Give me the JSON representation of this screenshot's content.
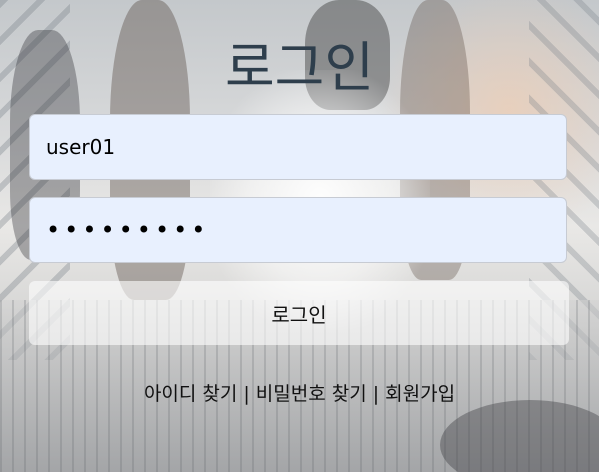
{
  "title": "로그인",
  "form": {
    "id_value": "user01",
    "password_value": "•••••••••",
    "submit_label": "로그인"
  },
  "links": {
    "find_id": "아이디 찾기",
    "separator": "|",
    "find_password": "비밀번호 찾기",
    "signup": "회원가입"
  }
}
